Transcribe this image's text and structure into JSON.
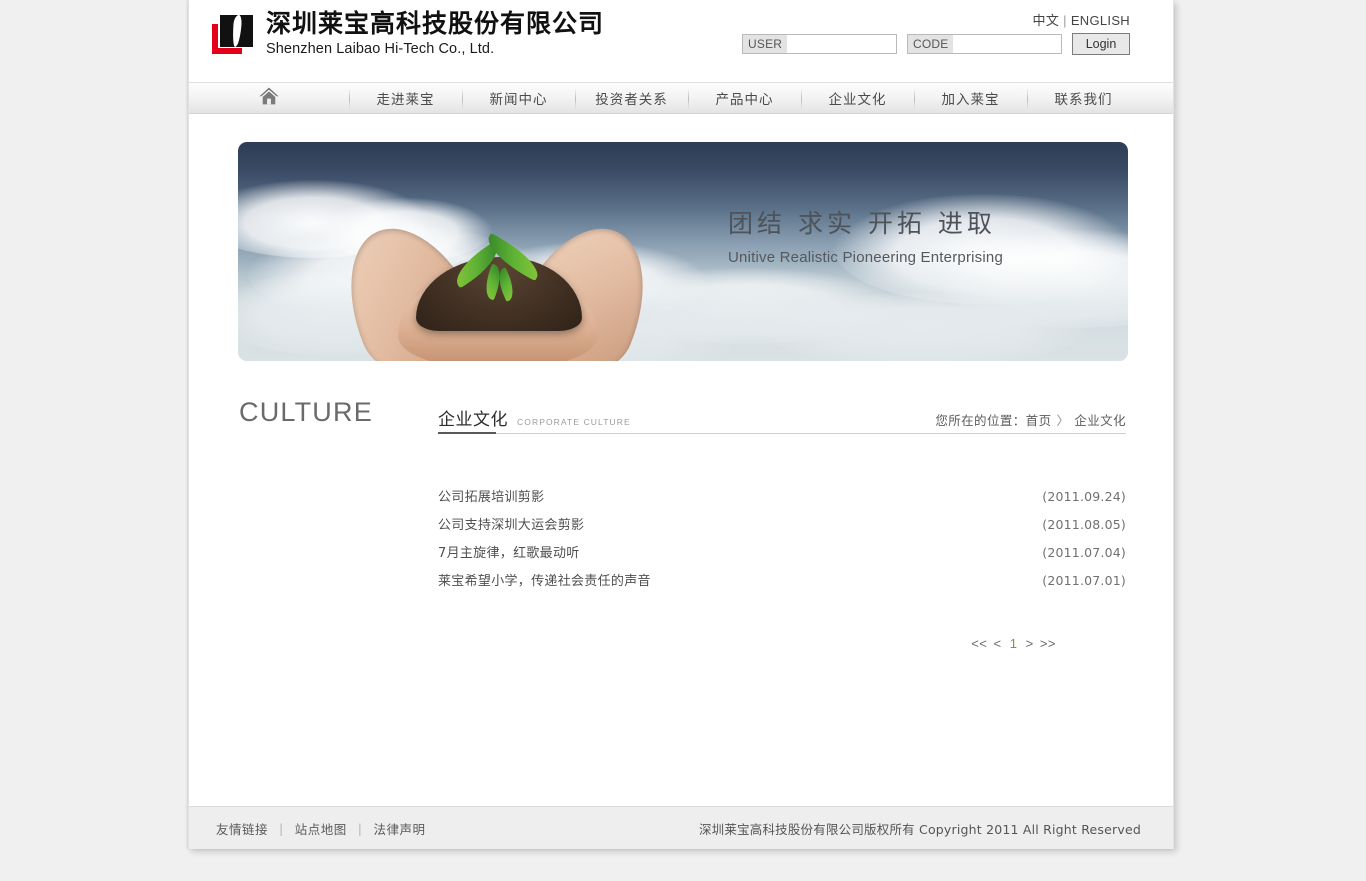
{
  "header": {
    "logo": {
      "icon": "laibao-logo-mark",
      "company_cn": "深圳莱宝高科技股份有限公司",
      "company_en": "Shenzhen Laibao Hi-Tech Co., Ltd."
    },
    "lang": {
      "chinese": "中文",
      "separator": "|",
      "english": "ENGLISH"
    },
    "login": {
      "user_tag": "USER",
      "user_value": "",
      "user_placeholder": "",
      "code_tag": "CODE",
      "code_value": "",
      "code_placeholder": "",
      "button": "Login"
    }
  },
  "nav": {
    "home_icon": "home-icon",
    "items": [
      {
        "label": "走进莱宝"
      },
      {
        "label": "新闻中心"
      },
      {
        "label": "投资者关系"
      },
      {
        "label": "产品中心"
      },
      {
        "label": "企业文化"
      },
      {
        "label": "加入莱宝"
      },
      {
        "label": "联系我们"
      }
    ]
  },
  "banner": {
    "image": "hands-holding-soil-with-sprout",
    "slogan_cn": "团结  求实  开拓  进取",
    "slogan_en": "Unitive Realistic Pioneering Enterprising"
  },
  "content": {
    "page_word": "CULTURE",
    "section": {
      "title_cn": "企业文化",
      "title_en": "CORPORATE CULTURE"
    },
    "breadcrumb": {
      "label": "您所在的位置：",
      "home": "首页",
      "arrow": "〉",
      "current": "企业文化"
    },
    "articles": [
      {
        "title": "公司拓展培训剪影",
        "date": "(2011.09.24)"
      },
      {
        "title": "公司支持深圳大运会剪影",
        "date": "(2011.08.05)"
      },
      {
        "title": "7月主旋律，红歌最动听",
        "date": "(2011.07.04)"
      },
      {
        "title": "莱宝希望小学，传递社会责任的声音",
        "date": "(2011.07.01)"
      }
    ],
    "pager": {
      "first": "<<",
      "prev": "<",
      "current": "1",
      "next": ">",
      "last": ">>"
    }
  },
  "footer": {
    "links": [
      {
        "label": "友情链接"
      },
      {
        "label": "站点地图"
      },
      {
        "label": "法律声明"
      }
    ],
    "separator": "|",
    "copyright": "深圳莱宝高科技股份有限公司版权所有 Copyright 2011 All Right Reserved"
  },
  "colors": {
    "accent_red": "#e2001a",
    "page_bg": "#f0f0f0",
    "nav_text": "#4b4b4b",
    "pager_current": "#9c8b35"
  }
}
